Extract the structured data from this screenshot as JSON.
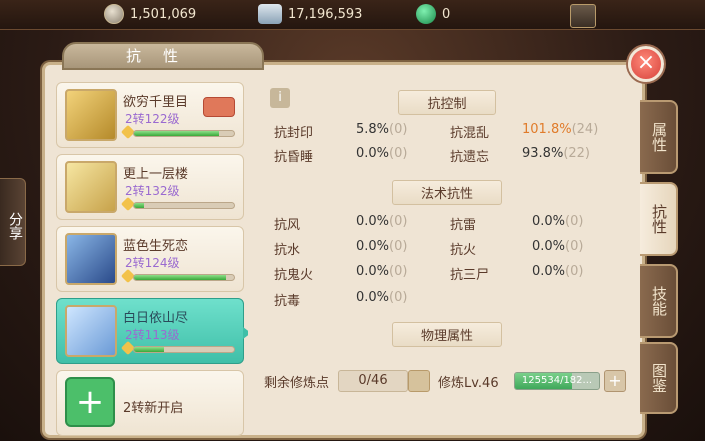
{
  "resources": {
    "coins": "1,501,069",
    "silver": "17,196,593",
    "jade": "0"
  },
  "share_label": "分享",
  "title": "抗性",
  "close_label": "×",
  "heroes": [
    {
      "name": "欲穷千里目",
      "level": "2转122级",
      "exp_fraction": 0.85,
      "selected": false
    },
    {
      "name": "更上一层楼",
      "level": "2转132级",
      "exp_fraction": 0.1,
      "selected": false
    },
    {
      "name": "蓝色生死恋",
      "level": "2转124级",
      "exp_fraction": 0.92,
      "selected": false
    },
    {
      "name": "白日依山尽",
      "level": "2转113级",
      "exp_fraction": 0.3,
      "selected": true
    },
    {
      "name": "2转新开启",
      "level": "",
      "exp_fraction": 0,
      "selected": false
    }
  ],
  "info_icon": "i",
  "sections": {
    "control": "抗控制",
    "magic": "法术抗性",
    "physical": "物理属性"
  },
  "control_stats": [
    {
      "label": "抗封印",
      "value": "5.8%",
      "extra": "(0)",
      "highlight": false
    },
    {
      "label": "抗混乱",
      "value": "101.8%",
      "extra": "(24)",
      "highlight": true
    },
    {
      "label": "抗昏睡",
      "value": "0.0%",
      "extra": "(0)",
      "highlight": false
    },
    {
      "label": "抗遗忘",
      "value": "93.8%",
      "extra": "(22)",
      "highlight": false
    }
  ],
  "magic_stats": [
    {
      "label": "抗风",
      "value": "0.0%",
      "extra": "(0)"
    },
    {
      "label": "抗雷",
      "value": "0.0%",
      "extra": "(0)"
    },
    {
      "label": "抗水",
      "value": "0.0%",
      "extra": "(0)"
    },
    {
      "label": "抗火",
      "value": "0.0%",
      "extra": "(0)"
    },
    {
      "label": "抗鬼火",
      "value": "0.0%",
      "extra": "(0)"
    },
    {
      "label": "抗三尸",
      "value": "0.0%",
      "extra": "(0)"
    },
    {
      "label": "抗毒",
      "value": "0.0%",
      "extra": "(0)"
    }
  ],
  "training": {
    "points_label": "剩余修炼点",
    "points_value": "0/46",
    "level_label": "修炼Lv.46",
    "exp_text": "125534/182...",
    "exp_fraction": 0.68,
    "plus": "+"
  },
  "side_tabs": [
    {
      "label": "属性",
      "active": false
    },
    {
      "label": "抗性",
      "active": true
    },
    {
      "label": "技能",
      "active": false
    },
    {
      "label": "图鉴",
      "active": false
    }
  ],
  "colors": {
    "panel_bg": "#efe4d4",
    "selected_card": "#3fbfa8",
    "highlight_value": "#e07b2a",
    "level_text": "#9a6ad0",
    "close_button": "#d6413a"
  }
}
